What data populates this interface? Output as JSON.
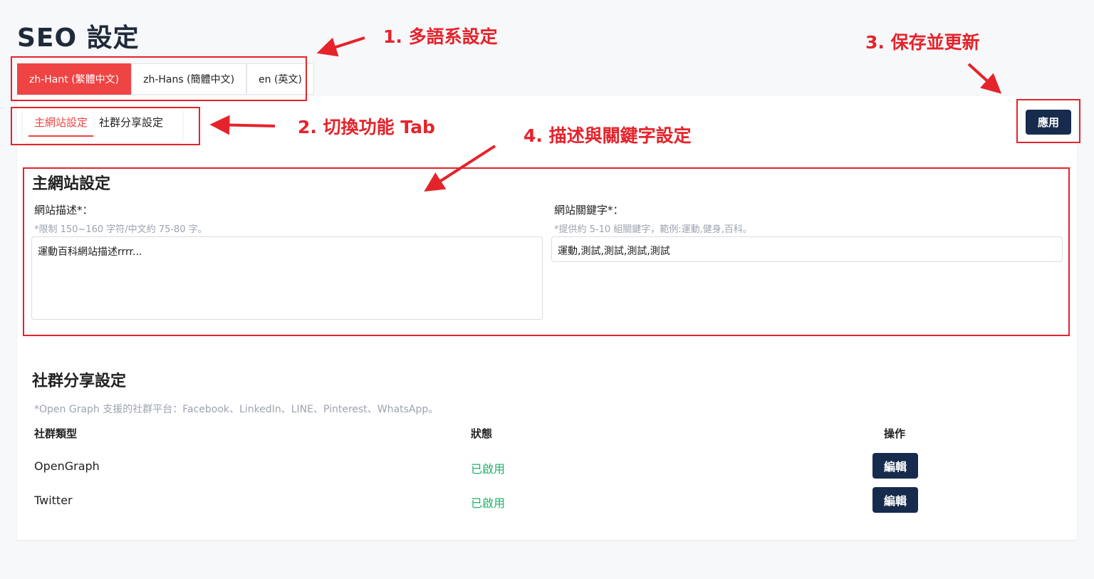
{
  "page": {
    "title": "SEO 設定"
  },
  "lang_tabs": [
    {
      "label": "zh-Hant (繁體中文)",
      "active": true
    },
    {
      "label": "zh-Hans (簡體中文)",
      "active": false
    },
    {
      "label": "en (英文)",
      "active": false
    }
  ],
  "func_tabs": [
    {
      "label": "主網站設定",
      "active": true
    },
    {
      "label": "社群分享設定",
      "active": false
    }
  ],
  "apply_label": "應用",
  "main_section": {
    "title": "主網站設定",
    "description": {
      "label": "網站描述*：",
      "hint": "*限制 150~160 字符/中文約 75-80 字。",
      "value": "運動百科網站描述rrrr..."
    },
    "keywords": {
      "label": "網站關鍵字*：",
      "hint": "*提供約 5-10 組關鍵字，範例:運動,健身,百科。",
      "value": "運動,測試,測試,測試,測試"
    }
  },
  "social_section": {
    "title": "社群分享設定",
    "hint": "*Open Graph 支援的社群平台：Facebook、LinkedIn、LINE、Pinterest、WhatsApp。",
    "columns": [
      "社群類型",
      "狀態",
      "操作"
    ],
    "rows": [
      {
        "type": "OpenGraph",
        "status": "已啟用",
        "action": "編輯"
      },
      {
        "type": "Twitter",
        "status": "已啟用",
        "action": "編輯"
      }
    ]
  },
  "annotations": {
    "a1": "1. 多語系設定",
    "a2": "2. 切換功能 Tab",
    "a3": "3. 保存並更新",
    "a4": "4. 描述與關鍵字設定"
  },
  "colors": {
    "accent": "#ef4444",
    "primary_button": "#172b4d",
    "status_enabled": "#22b16a",
    "annotation": "#e5232b"
  }
}
